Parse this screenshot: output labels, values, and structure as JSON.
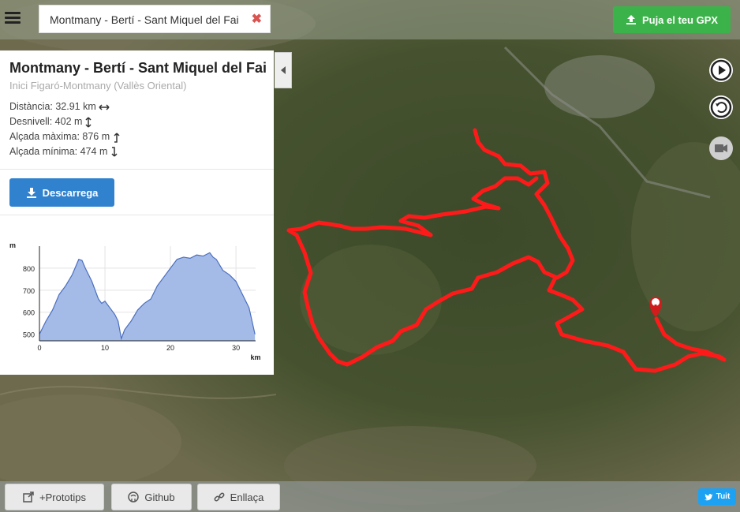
{
  "header": {
    "route_tab_title": "Montmany - Bertí - Sant Miquel del Fai",
    "close_symbol": "✖",
    "upload_gpx_label": "Puja el teu GPX"
  },
  "panel": {
    "title": "Montmany - Bertí - Sant Miquel del Fai",
    "subtitle": "Inici Figaró-Montmany (Vallès Oriental)",
    "stats": [
      {
        "label": "Distància: 32.91 km",
        "icon": "arrows-horizontal-icon"
      },
      {
        "label": "Desnivell: 402 m",
        "icon": "arrows-vertical-icon"
      },
      {
        "label": "Alçada màxima: 876 m",
        "icon": "arrow-up-icon"
      },
      {
        "label": "Alçada mínima: 474 m",
        "icon": "arrow-down-icon"
      }
    ],
    "download_label": "Descarrega"
  },
  "chart_data": {
    "type": "area",
    "xlabel": "km",
    "ylabel": "m",
    "xlim": [
      0,
      33
    ],
    "ylim": [
      470,
      900
    ],
    "xticks": [
      0,
      10,
      20,
      30
    ],
    "yticks": [
      500,
      600,
      700,
      800
    ],
    "color": "#a4bbe8",
    "line_color": "#4a6fbf",
    "series": [
      {
        "x": [
          0,
          0.5,
          1,
          2,
          3,
          4,
          5,
          6,
          6.5,
          7,
          8,
          9,
          9.5,
          10,
          11,
          11.5,
          12,
          12.5,
          13,
          14,
          15,
          16,
          17,
          18,
          19,
          20,
          21,
          22,
          23,
          24,
          25,
          26,
          26.5,
          27,
          28,
          29,
          30,
          31,
          32,
          32.9
        ],
        "y": [
          500,
          530,
          560,
          610,
          680,
          720,
          770,
          840,
          835,
          800,
          740,
          660,
          640,
          650,
          610,
          590,
          560,
          480,
          520,
          560,
          610,
          640,
          660,
          720,
          760,
          800,
          840,
          850,
          845,
          860,
          855,
          870,
          850,
          840,
          790,
          770,
          740,
          680,
          620,
          500
        ]
      }
    ]
  },
  "map": {
    "play_icon": "play-icon",
    "reset_icon": "reset-icon",
    "camera_icon": "video-camera-icon",
    "marker_icon": "hiker-marker-icon"
  },
  "footer": {
    "prototips_label": "+Prototips",
    "github_label": "Github",
    "link_label": "Enllaça",
    "tweet_label": "Tuit"
  },
  "colors": {
    "accent_green": "#3cb34a",
    "accent_blue": "#3182ce",
    "route_red": "#ff1a1a",
    "twitter_blue": "#1da1f2"
  }
}
